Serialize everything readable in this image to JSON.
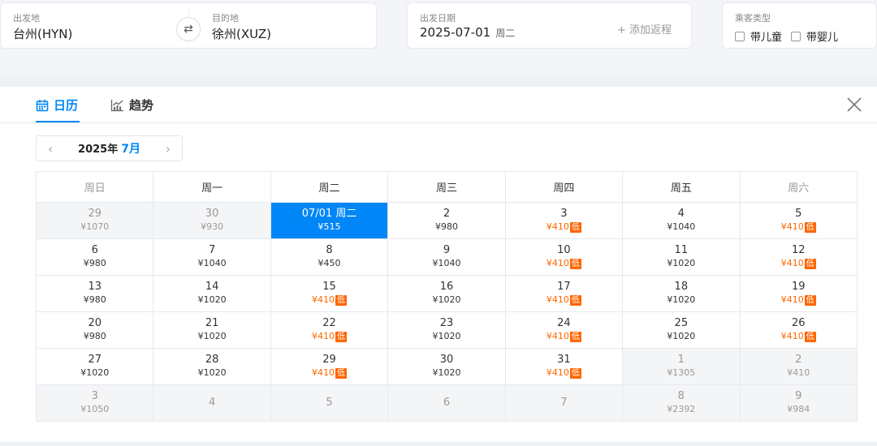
{
  "search": {
    "from_label": "出发地",
    "from_value": "台州(HYN)",
    "to_label": "目的地",
    "to_value": "徐州(XUZ)",
    "swap_icon": "⇄",
    "date_label": "出发日期",
    "date_value": "2025-07-01",
    "date_weekday": "周二",
    "add_return": "+ 添加返程",
    "pax_label": "乘客类型",
    "pax_child": "带儿童",
    "pax_infant": "带婴儿"
  },
  "tabs": {
    "calendar": "日历",
    "trend": "趋势"
  },
  "month_nav": {
    "year": "2025年",
    "month": "7月",
    "prev": "‹",
    "next": "›"
  },
  "weekdays": [
    "周日",
    "周一",
    "周二",
    "周三",
    "周四",
    "周五",
    "周六"
  ],
  "low_tag": "低",
  "weeks": [
    [
      {
        "d": "29",
        "p": "¥1070",
        "out": true
      },
      {
        "d": "30",
        "p": "¥930",
        "out": true
      },
      {
        "d": "07/01 周二",
        "p": "¥515",
        "sel": true
      },
      {
        "d": "2",
        "p": "¥980"
      },
      {
        "d": "3",
        "p": "¥410",
        "low": true
      },
      {
        "d": "4",
        "p": "¥1040"
      },
      {
        "d": "5",
        "p": "¥410",
        "low": true
      }
    ],
    [
      {
        "d": "6",
        "p": "¥980"
      },
      {
        "d": "7",
        "p": "¥1040"
      },
      {
        "d": "8",
        "p": "¥450"
      },
      {
        "d": "9",
        "p": "¥1040"
      },
      {
        "d": "10",
        "p": "¥410",
        "low": true
      },
      {
        "d": "11",
        "p": "¥1020"
      },
      {
        "d": "12",
        "p": "¥410",
        "low": true
      }
    ],
    [
      {
        "d": "13",
        "p": "¥980"
      },
      {
        "d": "14",
        "p": "¥1020"
      },
      {
        "d": "15",
        "p": "¥410",
        "low": true
      },
      {
        "d": "16",
        "p": "¥1020"
      },
      {
        "d": "17",
        "p": "¥410",
        "low": true
      },
      {
        "d": "18",
        "p": "¥1020"
      },
      {
        "d": "19",
        "p": "¥410",
        "low": true
      }
    ],
    [
      {
        "d": "20",
        "p": "¥980"
      },
      {
        "d": "21",
        "p": "¥1020"
      },
      {
        "d": "22",
        "p": "¥410",
        "low": true
      },
      {
        "d": "23",
        "p": "¥1020"
      },
      {
        "d": "24",
        "p": "¥410",
        "low": true
      },
      {
        "d": "25",
        "p": "¥1020"
      },
      {
        "d": "26",
        "p": "¥410",
        "low": true
      }
    ],
    [
      {
        "d": "27",
        "p": "¥1020"
      },
      {
        "d": "28",
        "p": "¥1020"
      },
      {
        "d": "29",
        "p": "¥410",
        "low": true
      },
      {
        "d": "30",
        "p": "¥1020"
      },
      {
        "d": "31",
        "p": "¥410",
        "low": true
      },
      {
        "d": "1",
        "p": "¥1305",
        "out": true
      },
      {
        "d": "2",
        "p": "¥410",
        "out": true
      }
    ],
    [
      {
        "d": "3",
        "p": "¥1050",
        "out": true
      },
      {
        "d": "4",
        "p": "",
        "out": true
      },
      {
        "d": "5",
        "p": "",
        "out": true
      },
      {
        "d": "6",
        "p": "",
        "out": true
      },
      {
        "d": "7",
        "p": "",
        "out": true
      },
      {
        "d": "8",
        "p": "¥2392",
        "out": true
      },
      {
        "d": "9",
        "p": "¥984",
        "out": true
      }
    ]
  ],
  "colors": {
    "accent": "#0086f6",
    "low_price": "#ff6600"
  }
}
